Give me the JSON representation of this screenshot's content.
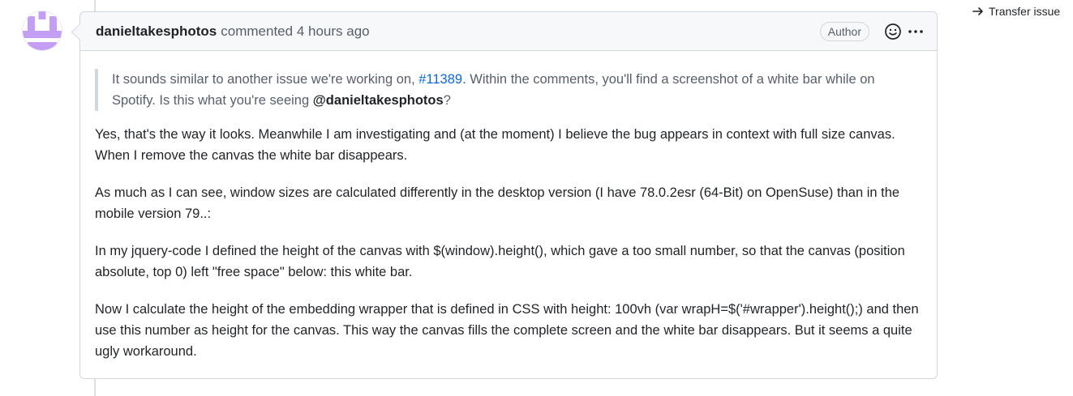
{
  "comment": {
    "author": "danieltakesphotos",
    "action": "commented",
    "timestamp": "4 hours ago",
    "badge": "Author",
    "icons": {
      "reaction": "smiley-icon",
      "menu": "kebab-horizontal-icon"
    },
    "quote": {
      "text_before_link": "It sounds similar to another issue we're working on, ",
      "link_text": "#11389",
      "text_after_link": ". Within the comments, you'll find a screenshot of a white bar while on Spotify. Is this what you're seeing ",
      "mention": "@danieltakesphotos",
      "text_end": "?"
    },
    "paragraphs": [
      "Yes, that's the way it looks. Meanwhile I am investigating and (at the moment) I believe the bug appears in context with full size canvas. When I remove the canvas the white bar disappears.",
      "As much as I can see, window sizes are calculated differently in the desktop version (I have 78.0.2esr (64-Bit) on OpenSuse) than in the mobile version 79..:",
      "In my jquery-code I defined the height of the canvas with $(window).height(), which gave a too small number, so that the canvas (position absolute, top 0) left \"free space\" below: this white bar.",
      "Now I calculate the height of the embedding wrapper that is defined in CSS with height: 100vh (var wrapH=$('#wrapper').height();) and then use this number as height for the canvas. This way the canvas fills the complete screen and the white bar disappears. But it seems a quite ugly workaround."
    ]
  },
  "sidebar": {
    "transfer_label": "Transfer issue",
    "transfer_icon": "arrow-right-icon"
  },
  "colors": {
    "link": "#0969da",
    "border": "#d0d7de",
    "header_bg": "#f6f8fa",
    "avatar_purple": "#c49ef5"
  }
}
